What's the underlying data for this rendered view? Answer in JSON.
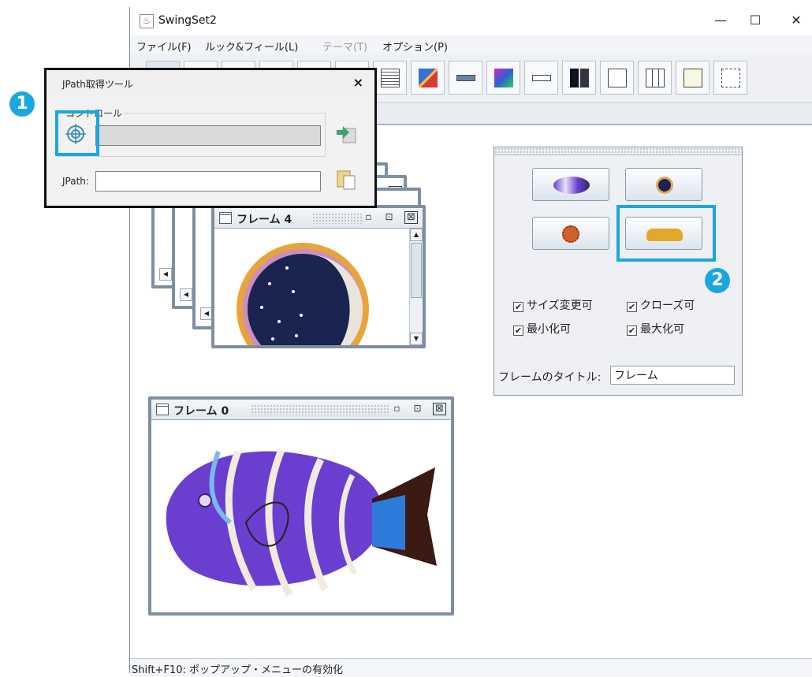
{
  "window": {
    "title": "SwingSet2",
    "controls": {
      "minimize": "—",
      "maximize": "☐",
      "close": "✕"
    }
  },
  "menubar": [
    {
      "label": "ファイル(F)",
      "enabled": true
    },
    {
      "label": "ルック&フィール(L)",
      "enabled": true
    },
    {
      "label": "テーマ(T)",
      "enabled": false
    },
    {
      "label": "オプション(P)",
      "enabled": true
    }
  ],
  "toolbar": {
    "buttons": [
      "internal-frame-demo",
      "button-demo",
      "color-chooser-demo",
      "combobox-demo",
      "file-chooser-demo",
      "html-demo",
      "list-demo",
      "option-pane-demo",
      "progress-bar-demo",
      "scroll-pane-demo",
      "slider-demo",
      "split-pane-demo",
      "tabbed-pane-demo",
      "table-demo",
      "tooltip-demo",
      "tree-demo"
    ]
  },
  "jpath_tool": {
    "title": "JPath取得ツール",
    "close": "×",
    "control_label": "コントロール",
    "control_value": "",
    "jpath_label": "JPath:",
    "jpath_value": ""
  },
  "frames": [
    {
      "title": "フレーム 4"
    },
    {
      "title": "フレーム 0"
    }
  ],
  "frame_buttons": {
    "iconify": "▫",
    "maximize": "⊡",
    "close": "⊠"
  },
  "control_panel": {
    "image_buttons": [
      "fish-icon",
      "moon-icon",
      "sun-icon",
      "taxi-icon"
    ],
    "checkboxes": [
      {
        "label": "サイズ変更可",
        "checked": true
      },
      {
        "label": "クローズ可",
        "checked": true
      },
      {
        "label": "最小化可",
        "checked": true
      },
      {
        "label": "最大化可",
        "checked": true
      }
    ],
    "title_label": "フレームのタイトル:",
    "title_value": "フレーム"
  },
  "annotations": {
    "badge1": "1",
    "badge2": "2",
    "color": "#1aa7e0"
  },
  "status": "Shift+F10: ポップアップ・メニューの有効化"
}
